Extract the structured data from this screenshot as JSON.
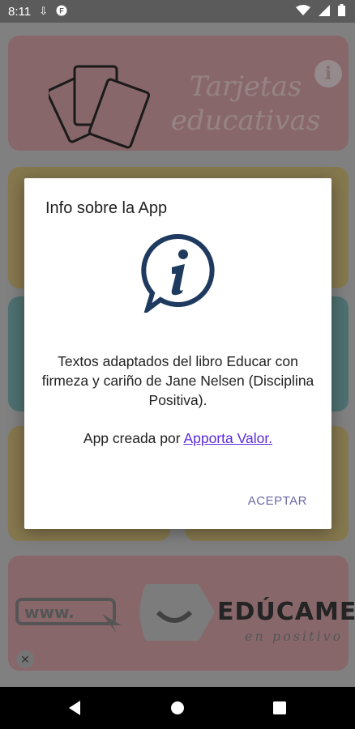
{
  "status_bar": {
    "time": "8:11",
    "icons": [
      "download-icon",
      "app-notification-icon",
      "wifi-icon",
      "signal-icon",
      "battery-icon"
    ]
  },
  "background": {
    "tarjetas_card": {
      "title_line1": "Tarjetas",
      "title_line2": "educativas"
    },
    "educame_card": {
      "brand": "EDÚCAME",
      "brand_sub": "en positivo",
      "www": "www."
    }
  },
  "dialog": {
    "title": "Info sobre la App",
    "body": "Textos adaptados del libro Educar con firmeza y cariño de Jane Nelsen (Disciplina Positiva).",
    "credit_prefix": "App creada por ",
    "credit_link": "Apporta Valor.",
    "accept_button": "ACEPTAR"
  },
  "colors": {
    "dialog_accent": "#6b68a8",
    "link": "#5b2bdc",
    "info_icon": "#1e3a5f"
  }
}
